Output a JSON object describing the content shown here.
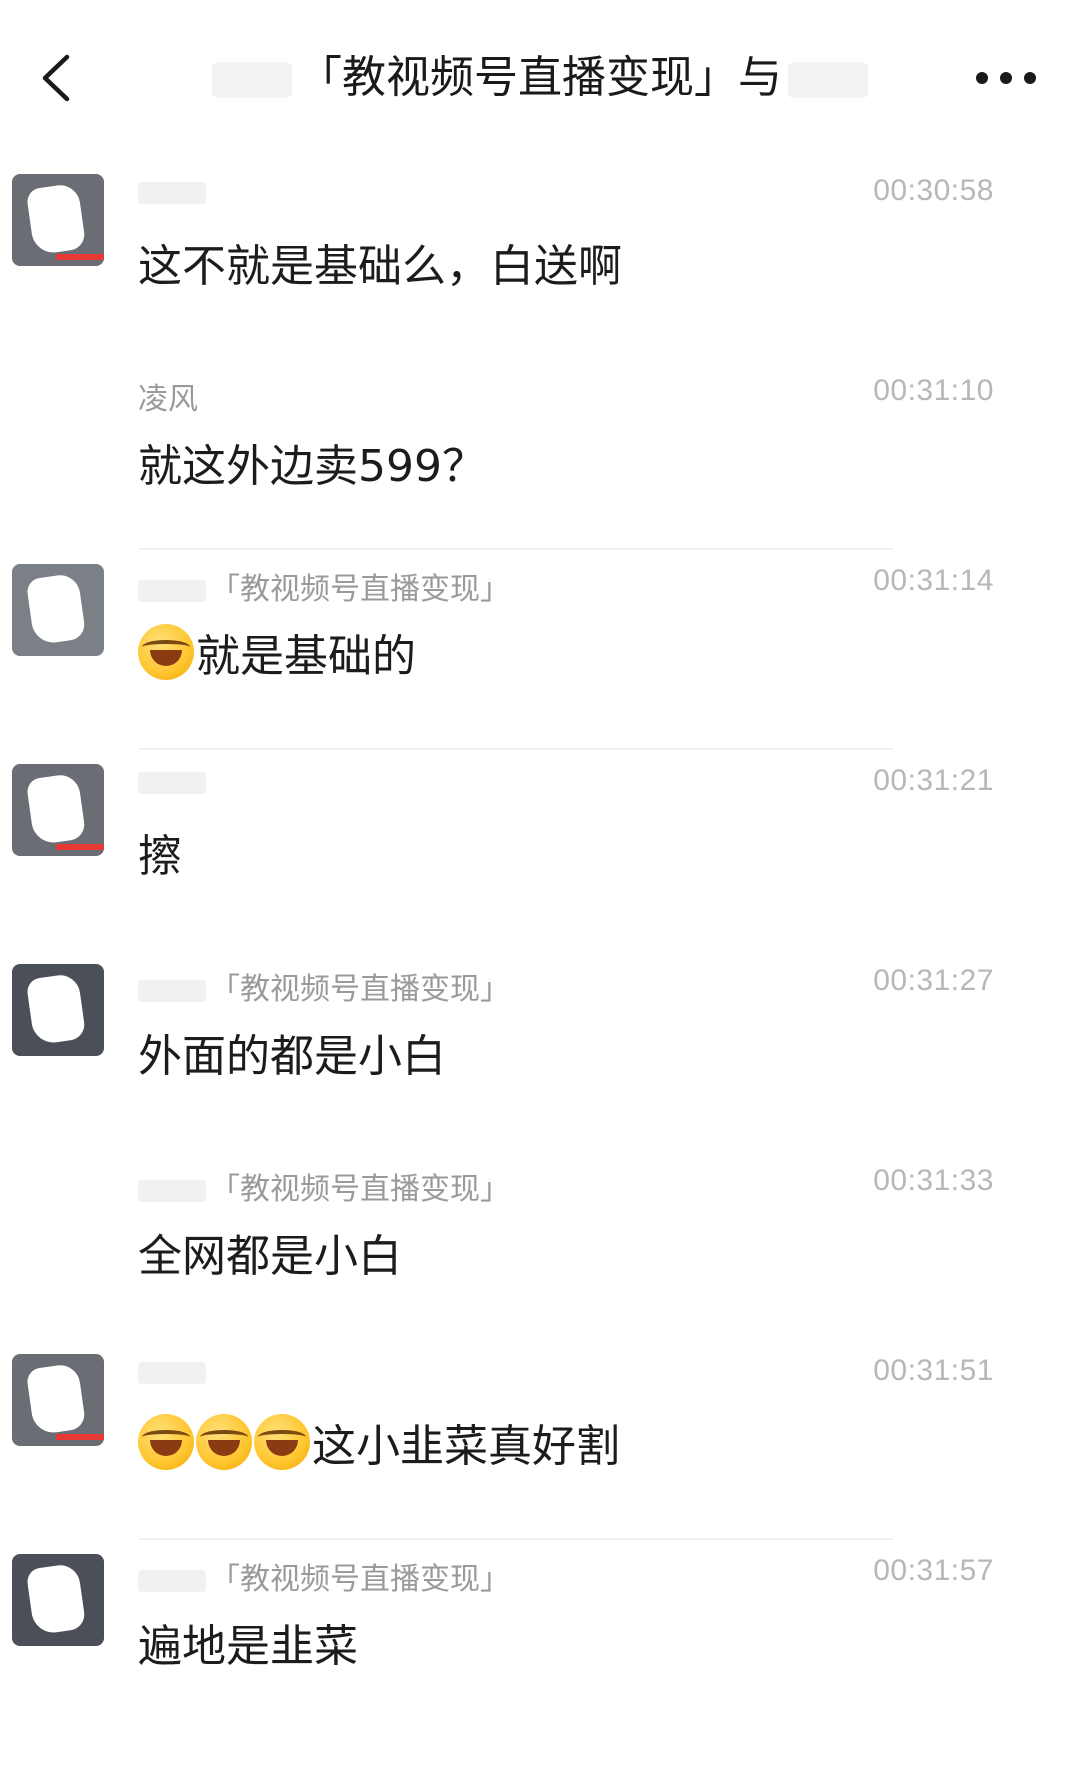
{
  "header": {
    "back_icon": "chevron-left-icon",
    "title": "「教视频号直播变现」与",
    "more_icon": "more-horizontal-icon"
  },
  "messages": [
    {
      "name": "",
      "time": "00:30:58",
      "text": "这不就是基础么，白送啊",
      "emoji_count": 0
    },
    {
      "name": "凌风",
      "time": "00:31:10",
      "text": "就这外边卖599？",
      "emoji_count": 0
    },
    {
      "name": "「教视频号直播变现」",
      "time": "00:31:14",
      "text": "就是基础的",
      "emoji_count": 1
    },
    {
      "name": "",
      "time": "00:31:21",
      "text": "擦",
      "emoji_count": 0
    },
    {
      "name": "「教视频号直播变现」",
      "time": "00:31:27",
      "text": "外面的都是小白",
      "emoji_count": 0
    },
    {
      "name": "「教视频号直播变现」",
      "time": "00:31:33",
      "text": "全网都是小白",
      "emoji_count": 0
    },
    {
      "name": "",
      "time": "00:31:51",
      "text": "这小韭菜真好割",
      "emoji_count": 3
    },
    {
      "name": "「教视频号直播变现」",
      "time": "00:31:57",
      "text": "遍地是韭菜",
      "emoji_count": 0
    }
  ]
}
